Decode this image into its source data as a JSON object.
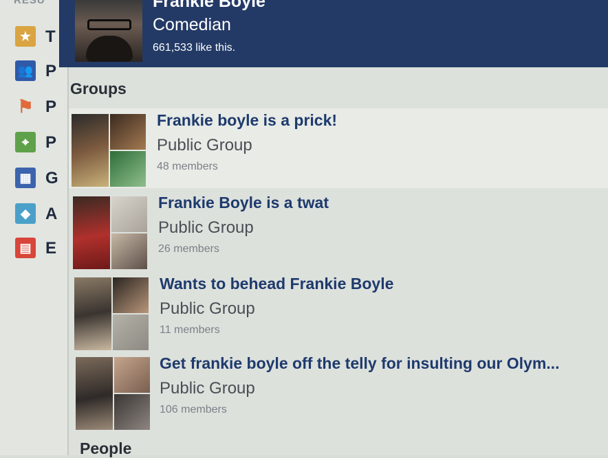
{
  "sidebar": {
    "heading": "RESU",
    "items": [
      {
        "icon": "star-icon",
        "letter": "T",
        "color": "#d9a441"
      },
      {
        "icon": "people-icon",
        "letter": "P",
        "color": "#2f5aa8"
      },
      {
        "icon": "flag-icon",
        "letter": "P",
        "color": "#e06a3a"
      },
      {
        "icon": "map-pin-icon",
        "letter": "P",
        "color": "#5fa14a"
      },
      {
        "icon": "group-icon",
        "letter": "G",
        "color": "#3c63ad"
      },
      {
        "icon": "app-cube-icon",
        "letter": "A",
        "color": "#4aa0c8"
      },
      {
        "icon": "calendar-icon",
        "letter": "E",
        "color": "#d8453a"
      }
    ]
  },
  "page_result": {
    "name": "Frankie Boyle",
    "category": "Comedian",
    "likes": "661,533 like this."
  },
  "groups_section": {
    "title": "Groups",
    "items": [
      {
        "name": "Frankie boyle is a prick!",
        "type": "Public Group",
        "members": "48 members"
      },
      {
        "name": "Frankie Boyle is a twat",
        "type": "Public Group",
        "members": "26 members"
      },
      {
        "name": "Wants to behead Frankie Boyle",
        "type": "Public Group",
        "members": "11 members"
      },
      {
        "name": "Get frankie boyle off the telly for insulting our Olym...",
        "type": "Public Group",
        "members": "106 members"
      }
    ]
  },
  "people_section": {
    "title": "People"
  },
  "colors": {
    "header_bg": "#233a66",
    "link": "#1e3a6d"
  }
}
